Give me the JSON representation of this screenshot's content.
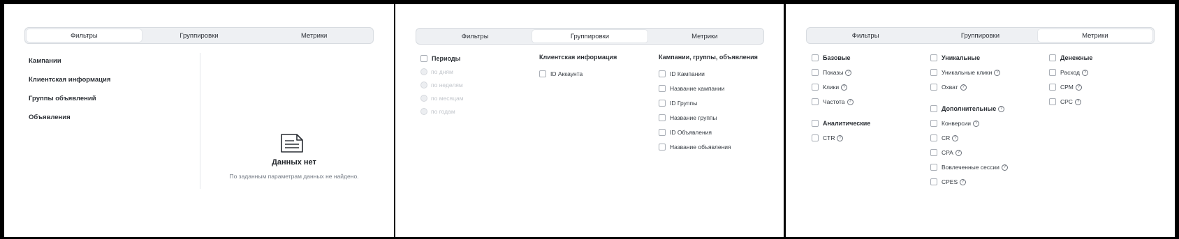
{
  "tabs": {
    "filters": "Фильтры",
    "groupings": "Группировки",
    "metrics": "Метрики"
  },
  "panel1": {
    "active_tab": "filters",
    "filter_items": [
      "Кампании",
      "Клиентская информация",
      "Группы объявлений",
      "Объявления"
    ],
    "empty_state": {
      "icon": "document-icon",
      "title": "Данных нет",
      "subtitle": "По заданным параметрам данных не найдено."
    }
  },
  "panel2": {
    "active_tab": "groupings",
    "periods": {
      "label": "Периоды",
      "options": [
        "по дням",
        "по неделям",
        "по месяцам",
        "по годам"
      ]
    },
    "client_info": {
      "heading": "Клиентская информация",
      "items": [
        "ID Аккаунта"
      ]
    },
    "campaigns": {
      "heading": "Кампании, группы, объявления",
      "items": [
        "ID Кампании",
        "Название кампании",
        "ID Группы",
        "Название группы",
        "ID Объявления",
        "Название объявления"
      ]
    }
  },
  "panel3": {
    "active_tab": "metrics",
    "help_glyph": "?",
    "basic": {
      "label": "Базовые",
      "items": [
        "Показы",
        "Клики",
        "Частота"
      ]
    },
    "analytic": {
      "label": "Аналитические",
      "items": [
        "CTR"
      ]
    },
    "unique": {
      "label": "Уникальные",
      "items": [
        "Уникальные клики",
        "Охват"
      ]
    },
    "additional": {
      "label": "Дополнительные",
      "items": [
        "Конверсии",
        "CR",
        "CPA",
        "Вовлеченные сессии",
        "CPES"
      ]
    },
    "money": {
      "label": "Денежные",
      "items": [
        "Расход",
        "CPM",
        "CPC"
      ]
    }
  }
}
